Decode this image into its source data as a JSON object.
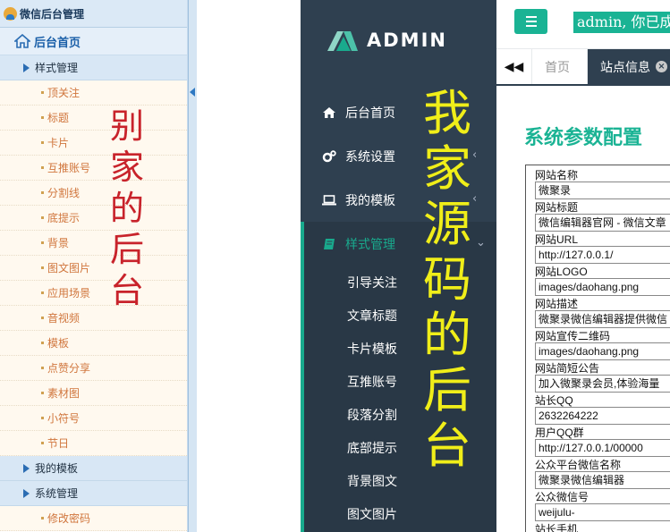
{
  "left_panel": {
    "header_title": "微信后台管理",
    "home_label": "后台首页",
    "groups": {
      "style": "样式管理",
      "templates": "我的模板",
      "system": "系统管理"
    },
    "style_items": [
      "顶关注",
      "标题",
      "卡片",
      "互推账号",
      "分割线",
      "底提示",
      "背景",
      "图文图片",
      "应用场景",
      "音视频",
      "模板",
      "点赞分享",
      "素材图",
      "小符号",
      "节日"
    ],
    "system_items": [
      "修改密码"
    ],
    "overlay_text": "别家的后台",
    "accent_color": "#2b6db3",
    "overlay_color": "#c8232b"
  },
  "app": {
    "brand": "ADMIN",
    "nav": [
      {
        "label": "后台首页",
        "icon": "home-icon"
      },
      {
        "label": "系统设置",
        "icon": "gears-icon"
      },
      {
        "label": "我的模板",
        "icon": "laptop-icon"
      },
      {
        "label": "样式管理",
        "icon": "book-icon"
      }
    ],
    "submenu": [
      "引导关注",
      "文章标题",
      "卡片模板",
      "互推账号",
      "段落分割",
      "底部提示",
      "背景图文",
      "图文图片"
    ],
    "overlay_text": "我家源码的后台",
    "overlay_color": "#f0ee19",
    "accent_color": "#1ab394",
    "sidebar_color": "#2f4050",
    "welcome": "admin, 你已成",
    "tabs": {
      "home": "首页",
      "active": "站点信息"
    },
    "page_title": "系统参数配置",
    "form": [
      {
        "label": "网站名称",
        "value": "微聚录"
      },
      {
        "label": "网站标题",
        "value": "微信编辑器官网 - 微信文章"
      },
      {
        "label": "网站URL",
        "value": "http://127.0.0.1/"
      },
      {
        "label": "网站LOGO",
        "value": "images/daohang.png"
      },
      {
        "label": "网站描述",
        "value": "微聚录微信编辑器提供微信"
      },
      {
        "label": "网站宣传二维码",
        "value": "images/daohang.png"
      },
      {
        "label": "网站简短公告",
        "value": "加入微聚录会员,体验海量"
      },
      {
        "label": "站长QQ",
        "value": "2632264222"
      },
      {
        "label": "用户QQ群",
        "value": "http://127.0.0.1/00000"
      },
      {
        "label": "公众平台微信名称",
        "value": "微聚录微信编辑器"
      },
      {
        "label": "公众微信号",
        "value": "weijulu-"
      },
      {
        "label": "站长手机",
        "value": ""
      }
    ]
  }
}
